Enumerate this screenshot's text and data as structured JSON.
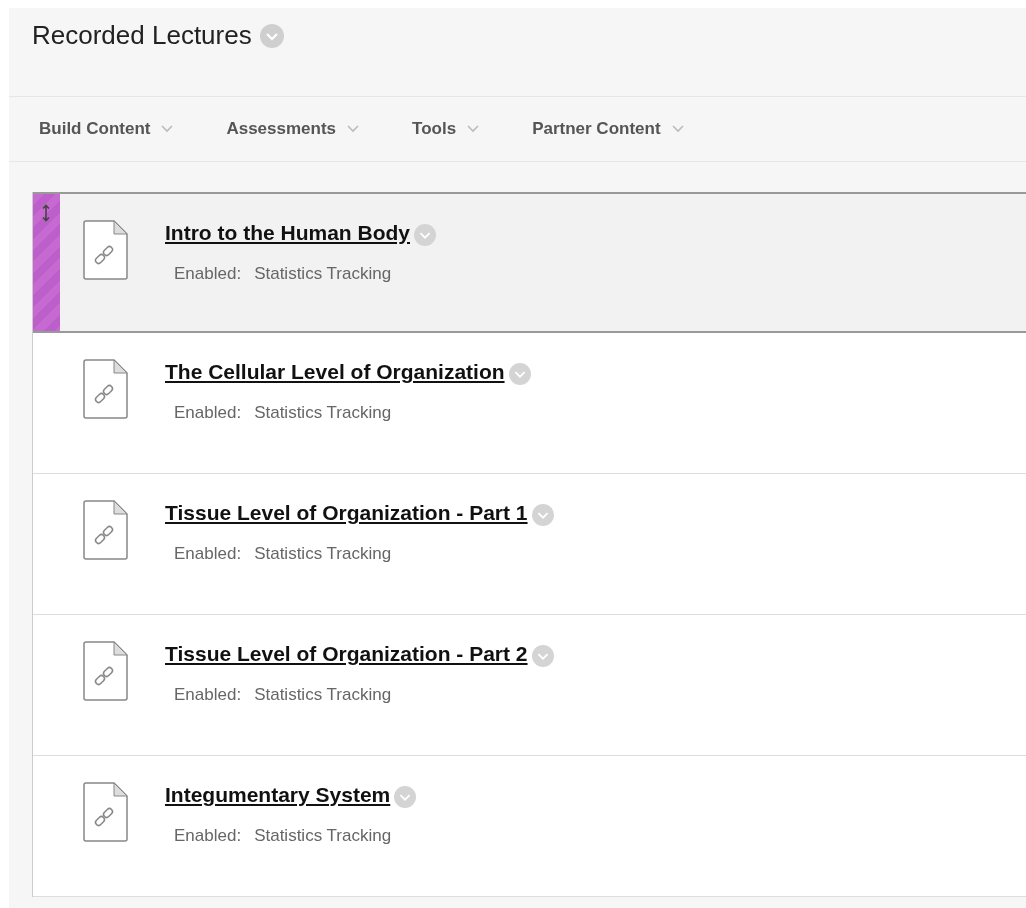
{
  "page": {
    "title": "Recorded Lectures"
  },
  "toolbar": [
    {
      "label": "Build Content"
    },
    {
      "label": "Assessments"
    },
    {
      "label": "Tools"
    },
    {
      "label": "Partner Content"
    }
  ],
  "items": [
    {
      "title": "Intro to the Human Body",
      "enabled_label": "Enabled:",
      "enabled_value": "Statistics Tracking",
      "selected": true
    },
    {
      "title": "The Cellular Level of Organization",
      "enabled_label": "Enabled:",
      "enabled_value": "Statistics Tracking",
      "selected": false
    },
    {
      "title": "Tissue Level of Organization - Part 1",
      "enabled_label": "Enabled:",
      "enabled_value": "Statistics Tracking",
      "selected": false
    },
    {
      "title": "Tissue Level of Organization - Part 2",
      "enabled_label": "Enabled:",
      "enabled_value": "Statistics Tracking",
      "selected": false
    },
    {
      "title": "Integumentary System",
      "enabled_label": "Enabled:",
      "enabled_value": "Statistics Tracking",
      "selected": false
    }
  ]
}
